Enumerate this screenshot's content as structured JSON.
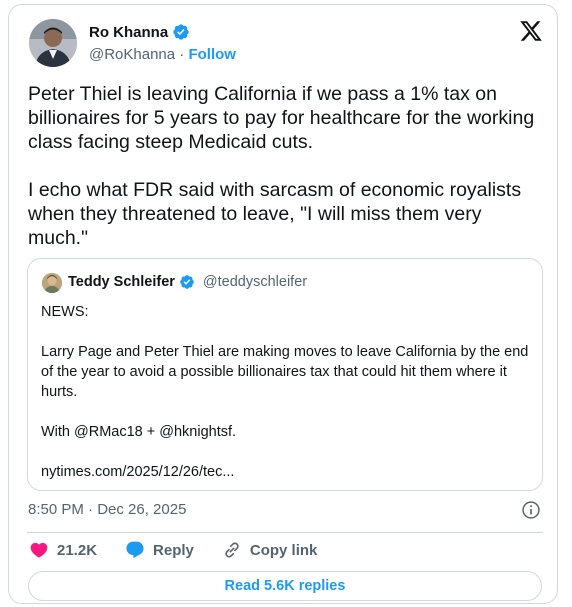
{
  "author": {
    "name": "Ro Khanna",
    "handle": "@RoKhanna",
    "separator": "·",
    "follow_label": "Follow"
  },
  "tweet_text": "Peter Thiel is leaving California if we pass a 1% tax on billionaires for 5 years to pay for healthcare for the working class facing steep Medicaid cuts.\n\nI echo what FDR said with sarcasm of economic royalists when they threatened to leave, \"I will miss them very much.\"",
  "quote": {
    "name": "Teddy Schleifer",
    "handle": "@teddyschleifer",
    "text": "NEWS:\n\nLarry Page and Peter Thiel are making moves to leave California by the end of the year to avoid a possible billionaires tax that could hit them where it hurts.\n\nWith @RMac18 + @hknightsf.\n\nnytimes.com/2025/12/26/tec..."
  },
  "meta": {
    "timestamp": "8:50 PM · Dec 26, 2025"
  },
  "actions": {
    "likes": "21.2K",
    "reply_label": "Reply",
    "copy_label": "Copy link"
  },
  "read_replies_label": "Read 5.6K replies",
  "colors": {
    "accent": "#1d9bf0",
    "like": "#f91880",
    "muted": "#536471",
    "border": "#cfd9de"
  },
  "icons": [
    "verified-badge-icon",
    "x-logo-icon",
    "info-icon",
    "heart-icon",
    "reply-bubble-icon",
    "link-icon"
  ]
}
